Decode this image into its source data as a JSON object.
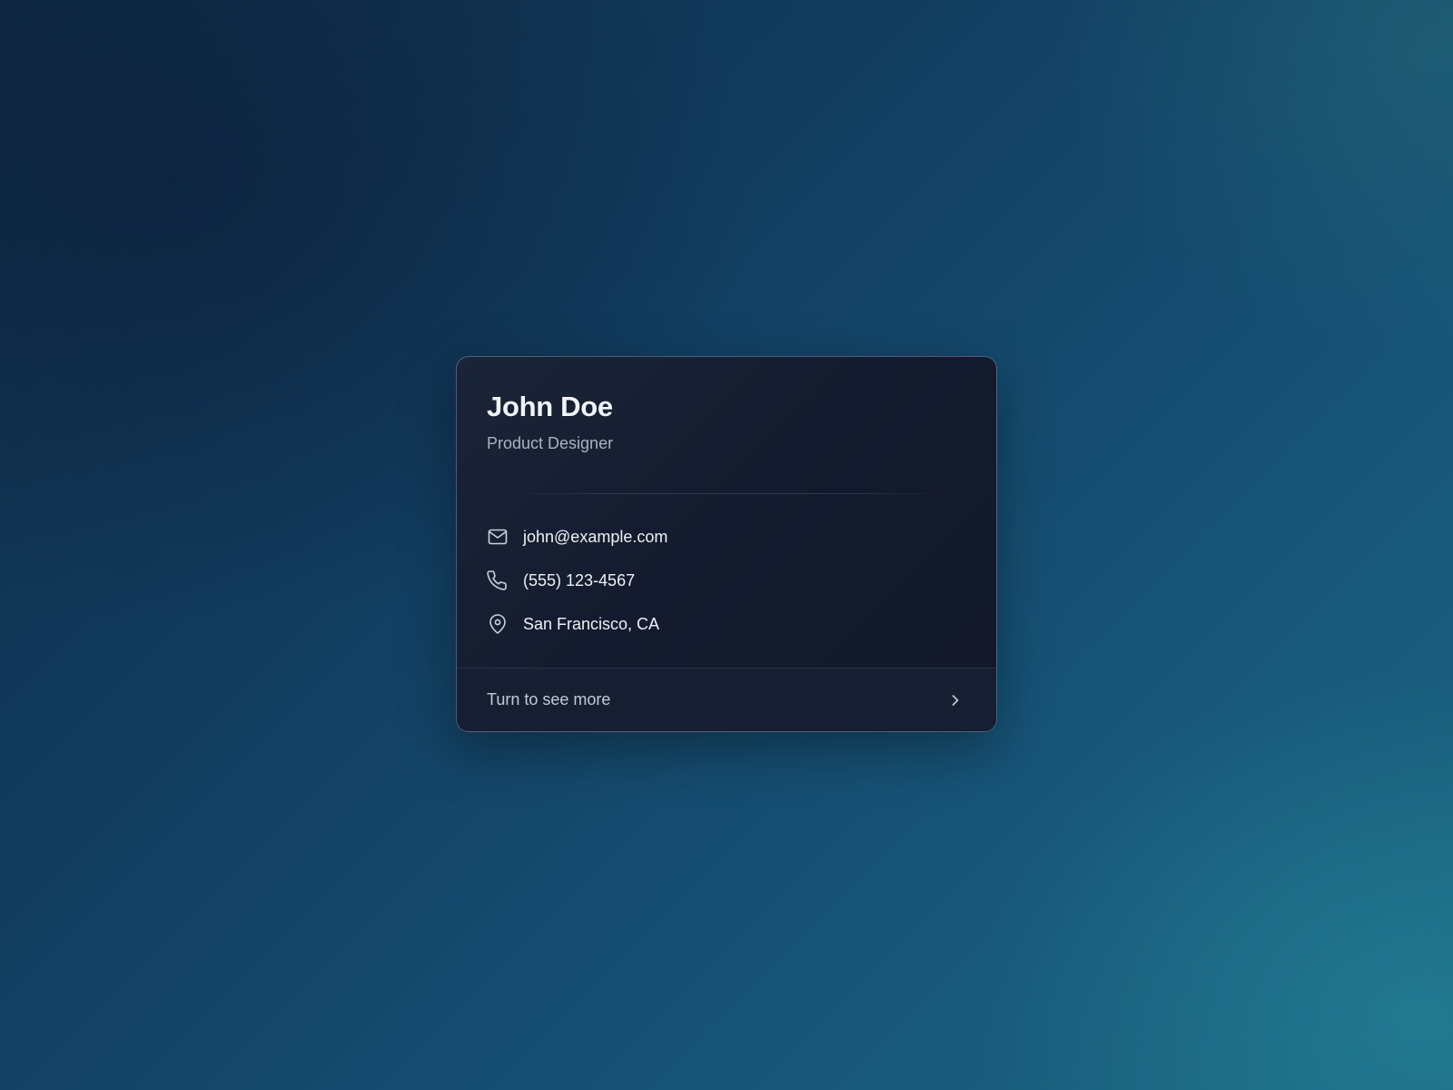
{
  "card": {
    "name": "John Doe",
    "title": "Product Designer",
    "contacts": [
      {
        "icon": "mail-icon",
        "text": "john@example.com"
      },
      {
        "icon": "phone-icon",
        "text": "(555) 123-4567"
      },
      {
        "icon": "map-pin-icon",
        "text": "San Francisco, CA"
      }
    ],
    "footer": {
      "label": "Turn to see more",
      "icon": "chevron-right-icon"
    }
  },
  "colors": {
    "card_background": "#141b2e",
    "card_border": "#96afd2",
    "name_text": "#f1f4f9",
    "secondary_text": "#a9b3c3",
    "icon_stroke": "#c9d1dc"
  }
}
